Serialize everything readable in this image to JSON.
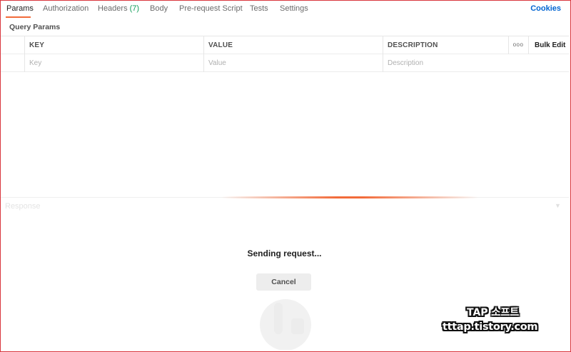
{
  "tabs": [
    {
      "label": "Params"
    },
    {
      "label": "Authorization"
    },
    {
      "label": "Headers",
      "count": "(7)"
    },
    {
      "label": "Body"
    },
    {
      "label": "Pre-request Script"
    },
    {
      "label": "Tests"
    },
    {
      "label": "Settings"
    }
  ],
  "cookies_label": "Cookies",
  "section_label": "Query Params",
  "table": {
    "headers": [
      "KEY",
      "VALUE",
      "DESCRIPTION"
    ],
    "more_label": "ooo",
    "bulk_edit_label": "Bulk Edit",
    "placeholders": {
      "key": "Key",
      "value": "Value",
      "description": "Description"
    }
  },
  "response": {
    "label": "Response",
    "sending_text": "Sending request...",
    "cancel_label": "Cancel"
  },
  "watermark": {
    "line1": "TAP 소프트",
    "line2": "tttap.tistory.com"
  },
  "colors": {
    "accent": "#f26b3a",
    "link": "#0265d2",
    "count": "#0f9d58",
    "frame": "#d9363e"
  }
}
